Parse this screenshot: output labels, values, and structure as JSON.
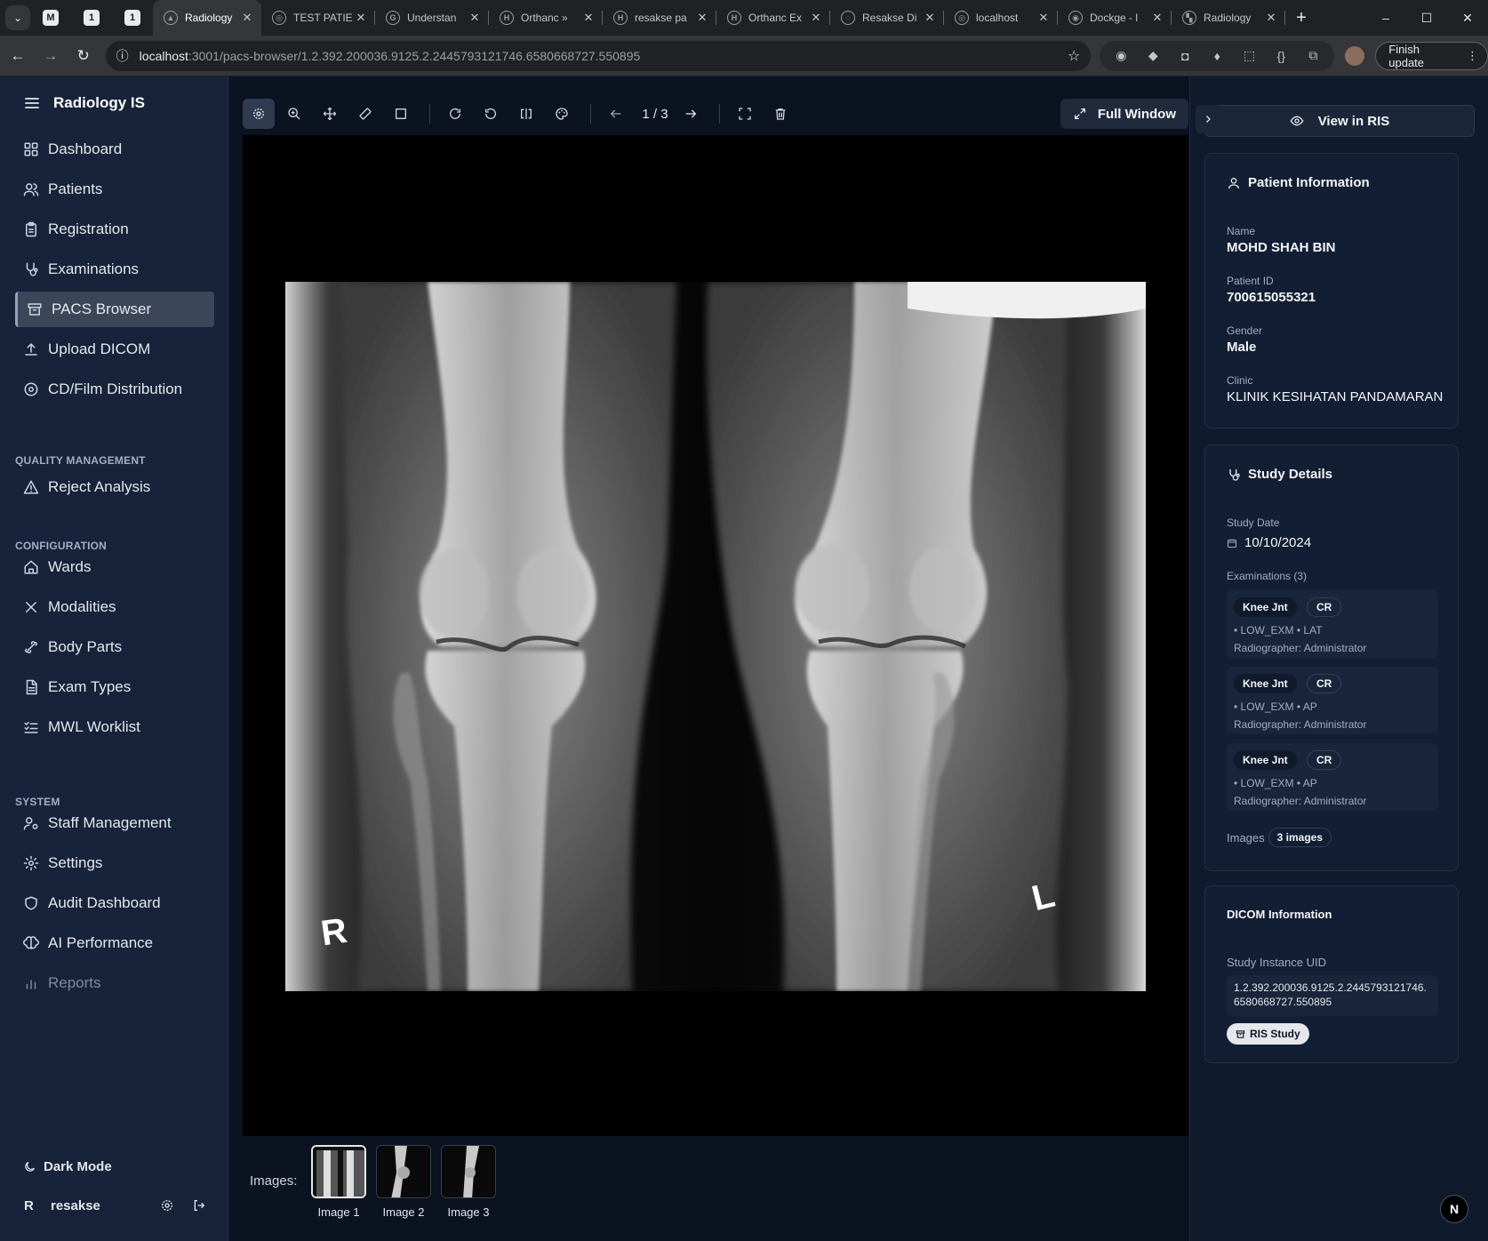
{
  "browser": {
    "pinned_tabs": [
      "M",
      "1",
      "1"
    ],
    "tabs": [
      {
        "title": "Radiology",
        "active": true,
        "fav": "▲"
      },
      {
        "title": "TEST PATIE",
        "fav": "◎"
      },
      {
        "title": "Understan",
        "fav": "G"
      },
      {
        "title": "Orthanc »",
        "fav": "H"
      },
      {
        "title": "resakse pa",
        "fav": "H"
      },
      {
        "title": "Orthanc Ex",
        "fav": "H"
      },
      {
        "title": "Resakse Di",
        "fav": "◌"
      },
      {
        "title": "localhost",
        "fav": "◎"
      },
      {
        "title": "Dockge - l",
        "fav": "◉"
      },
      {
        "title": "Radiology",
        "fav": "▚"
      }
    ],
    "url_host": "localhost",
    "url_path": ":3001/pacs-browser/1.2.392.200036.9125.2.2445793121746.6580668727.550895",
    "finish_update": "Finish update"
  },
  "sidebar": {
    "app_title": "Radiology IS",
    "main_items": [
      {
        "label": "Dashboard",
        "icon": "dashboard-icon"
      },
      {
        "label": "Patients",
        "icon": "users-icon"
      },
      {
        "label": "Registration",
        "icon": "clipboard-icon"
      },
      {
        "label": "Examinations",
        "icon": "stethoscope-icon"
      },
      {
        "label": "PACS Browser",
        "icon": "archive-icon",
        "active": true
      },
      {
        "label": "Upload DICOM",
        "icon": "upload-icon"
      },
      {
        "label": "CD/Film Distribution",
        "icon": "disc-icon"
      }
    ],
    "quality_label": "QUALITY MANAGEMENT",
    "quality_items": [
      {
        "label": "Reject Analysis",
        "icon": "warning-icon"
      }
    ],
    "config_label": "CONFIGURATION",
    "config_items": [
      {
        "label": "Wards",
        "icon": "home-icon"
      },
      {
        "label": "Modalities",
        "icon": "x-icon"
      },
      {
        "label": "Body Parts",
        "icon": "bone-icon"
      },
      {
        "label": "Exam Types",
        "icon": "file-icon"
      },
      {
        "label": "MWL Worklist",
        "icon": "list-check-icon"
      }
    ],
    "system_label": "SYSTEM",
    "system_items": [
      {
        "label": "Staff Management",
        "icon": "user-cog-icon"
      },
      {
        "label": "Settings",
        "icon": "gear-icon"
      },
      {
        "label": "Audit Dashboard",
        "icon": "shield-icon"
      },
      {
        "label": "AI Performance",
        "icon": "brain-icon"
      },
      {
        "label": "Reports",
        "icon": "bar-chart-icon",
        "muted": true
      }
    ],
    "dark_mode_label": "Dark Mode",
    "user_initial": "R",
    "username": "resakse"
  },
  "viewer": {
    "counter": "1 / 3",
    "full_window": "Full Window",
    "images_label": "Images:",
    "thumbnails": [
      "Image 1",
      "Image 2",
      "Image 3"
    ],
    "marker_right": "R",
    "marker_left": "L"
  },
  "panel": {
    "view_ris": "View in RIS",
    "patient": {
      "title": "Patient Information",
      "name_label": "Name",
      "name": "MOHD SHAH BIN",
      "id_label": "Patient ID",
      "id": "700615055321",
      "gender_label": "Gender",
      "gender": "Male",
      "clinic_label": "Clinic",
      "clinic": "KLINIK KESIHATAN PANDAMARAN"
    },
    "study": {
      "title": "Study Details",
      "date_label": "Study Date",
      "date": "10/10/2024",
      "exams_label": "Examinations (3)",
      "exams": [
        {
          "part": "Knee Jnt",
          "modality": "CR",
          "meta": "• LOW_EXM   • LAT",
          "radiographer": "Radiographer: Administrator"
        },
        {
          "part": "Knee Jnt",
          "modality": "CR",
          "meta": "• LOW_EXM   • AP",
          "radiographer": "Radiographer: Administrator"
        },
        {
          "part": "Knee Jnt",
          "modality": "CR",
          "meta": "• LOW_EXM   • AP",
          "radiographer": "Radiographer: Administrator"
        }
      ],
      "images_label": "Images",
      "images_count": "3 images"
    },
    "dicom": {
      "title": "DICOM Information",
      "uid_label": "Study Instance UID",
      "uid": "1.2.392.200036.9125.2.2445793121746.6580668727.550895",
      "ris_badge": "RIS Study"
    },
    "corner_badge": "N"
  }
}
